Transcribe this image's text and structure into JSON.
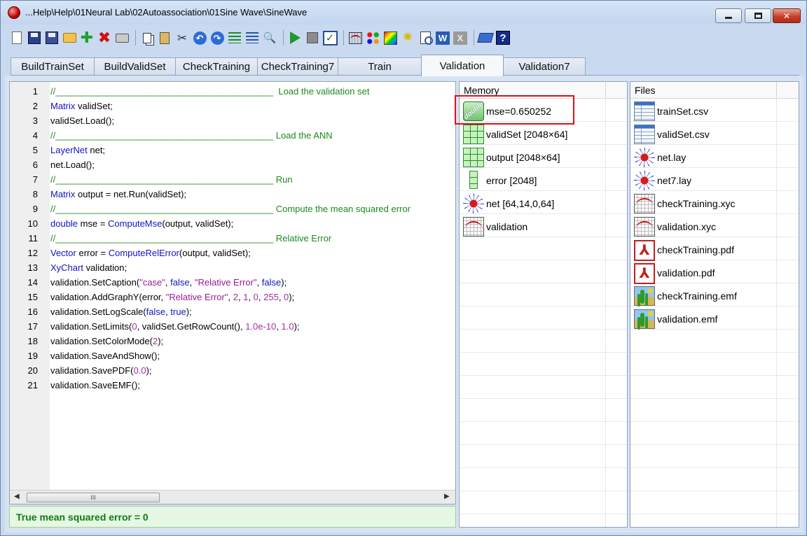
{
  "window": {
    "title": "...Help\\Help\\01Neural Lab\\02Autoassociation\\01Sine Wave\\SineWave"
  },
  "toolbar": {
    "buttons": [
      {
        "name": "new-doc-icon"
      },
      {
        "name": "save-icon"
      },
      {
        "name": "save-as-icon"
      },
      {
        "name": "open-folder-icon"
      },
      {
        "name": "add-icon"
      },
      {
        "name": "delete-icon"
      },
      {
        "name": "print-icon"
      },
      {
        "name": "copy-icon"
      },
      {
        "name": "paste-icon"
      },
      {
        "name": "cut-icon"
      },
      {
        "name": "undo-icon"
      },
      {
        "name": "redo-icon"
      },
      {
        "name": "indent-icon"
      },
      {
        "name": "outdent-icon"
      },
      {
        "name": "find-icon"
      },
      {
        "name": "run-icon"
      },
      {
        "name": "stop-icon"
      },
      {
        "name": "check-icon"
      },
      {
        "name": "chart-icon"
      },
      {
        "name": "palette-icon"
      },
      {
        "name": "color-icon"
      },
      {
        "name": "tip-icon"
      },
      {
        "name": "preview-icon"
      },
      {
        "name": "word-icon"
      },
      {
        "name": "excel-icon"
      },
      {
        "name": "manual-icon"
      },
      {
        "name": "help-icon"
      }
    ],
    "word_glyph": "W",
    "excel_glyph": "X",
    "help_glyph": "?"
  },
  "tabs": [
    {
      "label": "BuildTrainSet"
    },
    {
      "label": "BuildValidSet"
    },
    {
      "label": "CheckTraining"
    },
    {
      "label": "CheckTraining7"
    },
    {
      "label": "Train"
    },
    {
      "label": "Validation",
      "active": true
    },
    {
      "label": "Validation7"
    }
  ],
  "editor": {
    "lines": [
      {
        "n": "1",
        "parts": [
          [
            "cm",
            "//___________________________________________  Load the validation set"
          ]
        ]
      },
      {
        "n": "2",
        "parts": [
          [
            "kw",
            "Matrix"
          ],
          [
            "",
            " validSet;"
          ]
        ]
      },
      {
        "n": "3",
        "parts": [
          [
            "",
            "validSet.Load();"
          ]
        ]
      },
      {
        "n": "4",
        "parts": [
          [
            "cm",
            "//___________________________________________ Load the ANN"
          ]
        ]
      },
      {
        "n": "5",
        "parts": [
          [
            "kw",
            "LayerNet"
          ],
          [
            "",
            " net;"
          ]
        ]
      },
      {
        "n": "6",
        "parts": [
          [
            "",
            "net.Load();"
          ]
        ]
      },
      {
        "n": "7",
        "parts": [
          [
            "cm",
            "//___________________________________________ Run"
          ]
        ]
      },
      {
        "n": "8",
        "parts": [
          [
            "kw",
            "Matrix"
          ],
          [
            "",
            " output = net.Run(validSet);"
          ]
        ]
      },
      {
        "n": "9",
        "parts": [
          [
            "cm",
            "//___________________________________________ Compute the mean squared error"
          ]
        ]
      },
      {
        "n": "10",
        "parts": [
          [
            "kw",
            "double"
          ],
          [
            "",
            " mse = "
          ],
          [
            "fn",
            "ComputeMse"
          ],
          [
            "",
            "(output, validSet);"
          ]
        ]
      },
      {
        "n": "11",
        "parts": [
          [
            "cm",
            "//___________________________________________ Relative Error"
          ]
        ]
      },
      {
        "n": "12",
        "parts": [
          [
            "kw",
            "Vector"
          ],
          [
            "",
            " error = "
          ],
          [
            "fn",
            "ComputeRelError"
          ],
          [
            "",
            "(output, validSet);"
          ]
        ]
      },
      {
        "n": "13",
        "parts": [
          [
            "kw",
            "XyChart"
          ],
          [
            "",
            " validation;"
          ]
        ]
      },
      {
        "n": "14",
        "parts": [
          [
            "",
            "validation.SetCaption("
          ],
          [
            "st",
            "\"case\""
          ],
          [
            "",
            ", "
          ],
          [
            "kw",
            "false"
          ],
          [
            "",
            ", "
          ],
          [
            "st",
            "\"Relative Error\""
          ],
          [
            "",
            ", "
          ],
          [
            "kw",
            "false"
          ],
          [
            "",
            ");"
          ]
        ]
      },
      {
        "n": "15",
        "parts": [
          [
            "",
            "validation.AddGraphY(error, "
          ],
          [
            "st",
            "\"Relative Error\""
          ],
          [
            "",
            ", "
          ],
          [
            "nm",
            "2"
          ],
          [
            "",
            ", "
          ],
          [
            "nm",
            "1"
          ],
          [
            "",
            ", "
          ],
          [
            "nm",
            "0"
          ],
          [
            "",
            ", "
          ],
          [
            "nm",
            "255"
          ],
          [
            "",
            ", "
          ],
          [
            "nm",
            "0"
          ],
          [
            "",
            ");"
          ]
        ]
      },
      {
        "n": "16",
        "parts": [
          [
            "",
            "validation.SetLogScale("
          ],
          [
            "kw",
            "false"
          ],
          [
            "",
            ", "
          ],
          [
            "kw",
            "true"
          ],
          [
            "",
            ");"
          ]
        ]
      },
      {
        "n": "17",
        "parts": [
          [
            "",
            "validation.SetLimits("
          ],
          [
            "nm",
            "0"
          ],
          [
            "",
            ", validSet.GetRowCount(), "
          ],
          [
            "nm",
            "1.0e-10"
          ],
          [
            "",
            ", "
          ],
          [
            "nm",
            "1.0"
          ],
          [
            "",
            ");"
          ]
        ]
      },
      {
        "n": "18",
        "parts": [
          [
            "",
            "validation.SetColorMode("
          ],
          [
            "nm",
            "2"
          ],
          [
            "",
            ");"
          ]
        ]
      },
      {
        "n": "19",
        "parts": [
          [
            "",
            "validation.SaveAndShow();"
          ]
        ]
      },
      {
        "n": "20",
        "parts": [
          [
            "",
            "validation.SavePDF("
          ],
          [
            "nm",
            "0.0"
          ],
          [
            "",
            ");"
          ]
        ]
      },
      {
        "n": "21",
        "parts": [
          [
            "",
            "validation.SaveEMF();"
          ]
        ]
      }
    ],
    "scroll_thumb_glyph": "III",
    "scroll_left_glyph": "◀",
    "scroll_right_glyph": "▶"
  },
  "status": {
    "text": "True mean squared error = 0"
  },
  "memory": {
    "header": "Memory",
    "items": [
      {
        "icon": "double",
        "label": "mse=0.650252",
        "icon_text": "double"
      },
      {
        "icon": "matrix",
        "label": "validSet [2048×64]"
      },
      {
        "icon": "matrix",
        "label": "output [2048×64]"
      },
      {
        "icon": "vector",
        "label": "error [2048]"
      },
      {
        "icon": "net",
        "label": "net [64,14,0,64]"
      },
      {
        "icon": "xychart",
        "label": "validation"
      }
    ]
  },
  "files": {
    "header": "Files",
    "items": [
      {
        "icon": "csv",
        "label": "trainSet.csv"
      },
      {
        "icon": "csv",
        "label": "validSet.csv"
      },
      {
        "icon": "net",
        "label": "net.lay"
      },
      {
        "icon": "net",
        "label": "net7.lay"
      },
      {
        "icon": "xychart",
        "label": "checkTraining.xyc"
      },
      {
        "icon": "xychart",
        "label": "validation.xyc"
      },
      {
        "icon": "pdf",
        "label": "checkTraining.pdf"
      },
      {
        "icon": "pdf",
        "label": "validation.pdf"
      },
      {
        "icon": "emf",
        "label": "checkTraining.emf"
      },
      {
        "icon": "emf",
        "label": "validation.emf"
      }
    ]
  },
  "colors": {
    "keyword": "#1212c8",
    "comment": "#1c8a1c",
    "string": "#9a1a9a",
    "status_text": "#0f7a14",
    "highlight": "#e01010"
  }
}
